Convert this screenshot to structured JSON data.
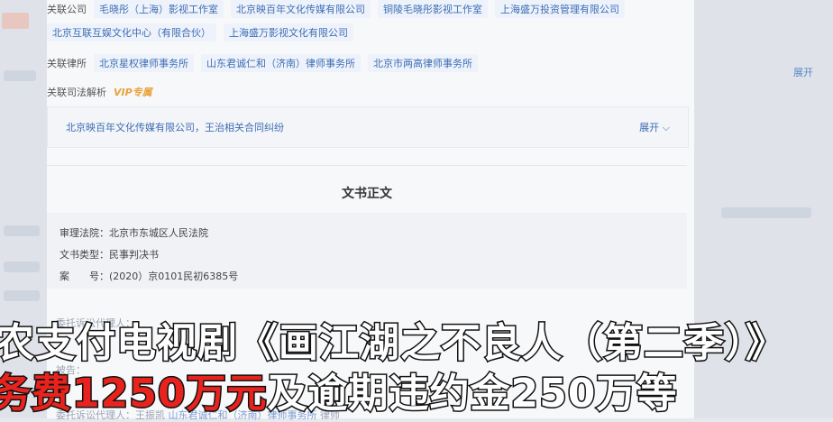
{
  "related_companies": {
    "label": "关联公司",
    "items": [
      "毛晓彤（上海）影视工作室",
      "北京映百年文化传媒有限公司",
      "铜陵毛晓彤影视工作室",
      "上海盛万投资管理有限公司",
      "北京互联互娱文化中心（有限合伙）",
      "上海盛万影视文化有限公司"
    ]
  },
  "related_law_firms": {
    "label": "关联律所",
    "items": [
      "北京星权律师事务所",
      "山东君诚仁和（济南）律师事务所",
      "北京市两高律师事务所"
    ]
  },
  "judicial_analysis": {
    "label": "关联司法解析",
    "vip": "VIP专属",
    "case_link": "北京映百年文化传媒有限公司，王治相关合同纠纷",
    "expand": "展开"
  },
  "document": {
    "title": "文书正文",
    "court": "审理法院：北京市东城区人民法院",
    "doc_type": "文书类型：民事判决书",
    "case_no_label": "案　　号：",
    "case_no": "(2020）京0101民初6385号"
  },
  "background": {
    "right_text": "展开",
    "blur_line1": "委托诉讼代理人：",
    "blur_line2": "被告：",
    "blur_line4_label": "委托诉讼代理人：王振凯",
    "blur_line4_link": "山东君诚仁和（济南）律师事务所",
    "blur_line4_tail": "律师"
  },
  "captions": {
    "line1": "农支付电视剧《画江湖之不良人（第二季）》",
    "line2_red": "务费1250万元",
    "line2_rest": "及逾期违约金250万等"
  }
}
